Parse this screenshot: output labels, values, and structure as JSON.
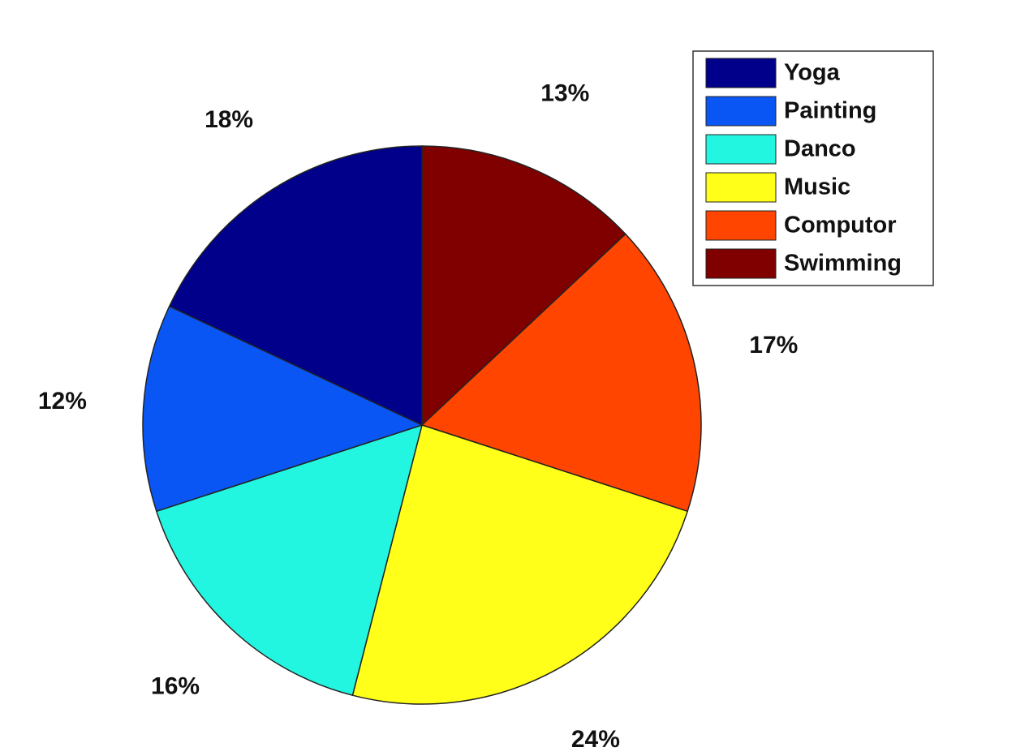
{
  "chart_data": {
    "type": "pie",
    "title": "",
    "slices": [
      {
        "label": "Swimming",
        "value": 13,
        "value_label": "13%",
        "color": "#800000"
      },
      {
        "label": "Computor",
        "value": 17,
        "value_label": "17%",
        "color": "#ff4500"
      },
      {
        "label": "Music",
        "value": 24,
        "value_label": "24%",
        "color": "#ffff1a"
      },
      {
        "label": "Danco",
        "value": 16,
        "value_label": "16%",
        "color": "#22f5e0"
      },
      {
        "label": "Painting",
        "value": 12,
        "value_label": "12%",
        "color": "#0a56f5"
      },
      {
        "label": "Yoga",
        "value": 18,
        "value_label": "18%",
        "color": "#00008b"
      }
    ],
    "start": "top",
    "direction": "clockwise",
    "legend": {
      "position": "top-right",
      "entries": [
        "Yoga",
        "Painting",
        "Danco",
        "Music",
        "Computor",
        "Swimming"
      ]
    }
  }
}
